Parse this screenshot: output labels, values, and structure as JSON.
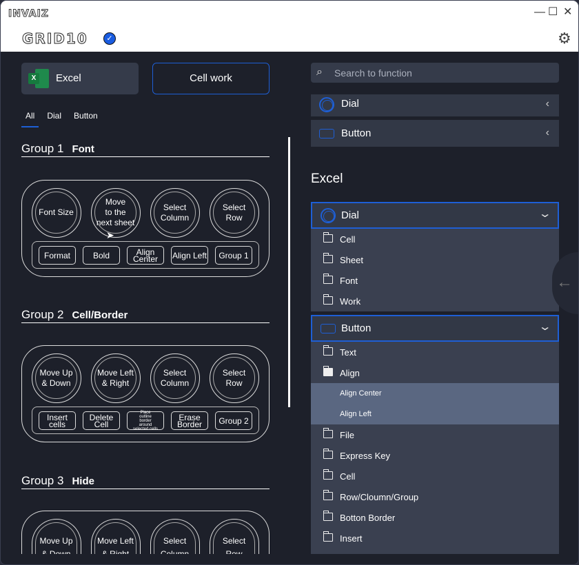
{
  "window": {
    "brand": "INVAIZ",
    "product": "GRID10",
    "minimize": "—",
    "maximize": "☐",
    "close": "✕"
  },
  "left": {
    "app_label": "Excel",
    "work_label": "Cell work",
    "tabs": [
      {
        "label": "All",
        "active": true
      },
      {
        "label": "Dial"
      },
      {
        "label": "Button"
      }
    ],
    "groups": [
      {
        "name": "Group 1",
        "desc": "Font",
        "dials": [
          "Font Size",
          "Move\nto the\nnext sheet",
          "Select\nColumn",
          "Select\nRow"
        ],
        "buttons": [
          "Format",
          "Bold",
          "Align\nCenter",
          "Align Left",
          "Group 1"
        ]
      },
      {
        "name": "Group 2",
        "desc": "Cell/Border",
        "dials": [
          "Move Up\n& Down",
          "Move Left\n& Right",
          "Select\nColumn",
          "Select\nRow"
        ],
        "buttons": [
          "Insert\ncells",
          "Delete\nCell",
          "Place\noutline\nborder\naround\nselected cells",
          "Erase\nBorder",
          "Group 2"
        ]
      },
      {
        "name": "Group 3",
        "desc": "Hide",
        "dials": [
          "Move Up\n& Down",
          "Move Left\n& Right",
          "Select\nColumn",
          "Select\nRow"
        ],
        "buttons": []
      }
    ]
  },
  "right": {
    "search_placeholder": "Search to function",
    "categories": [
      {
        "label": "Dial",
        "icon": "dial-icon"
      },
      {
        "label": "Button",
        "icon": "button-icon"
      }
    ],
    "section_title": "Excel",
    "dial_acc": {
      "label": "Dial",
      "items": [
        "Cell",
        "Sheet",
        "Font",
        "Work"
      ]
    },
    "button_acc": {
      "label": "Button",
      "items": [
        {
          "label": "Text"
        },
        {
          "label": "Align",
          "open": true,
          "children": [
            "Align Center",
            "Align Left"
          ]
        },
        {
          "label": "File"
        },
        {
          "label": "Express Key"
        },
        {
          "label": "Cell"
        },
        {
          "label": "Row/Cloumn/Group"
        },
        {
          "label": "Botton Border"
        },
        {
          "label": "Insert"
        }
      ]
    }
  },
  "colors": {
    "accent": "#1e5fd6",
    "background": "#1d202a",
    "panel": "#323846",
    "highlight": "#5a6781"
  }
}
